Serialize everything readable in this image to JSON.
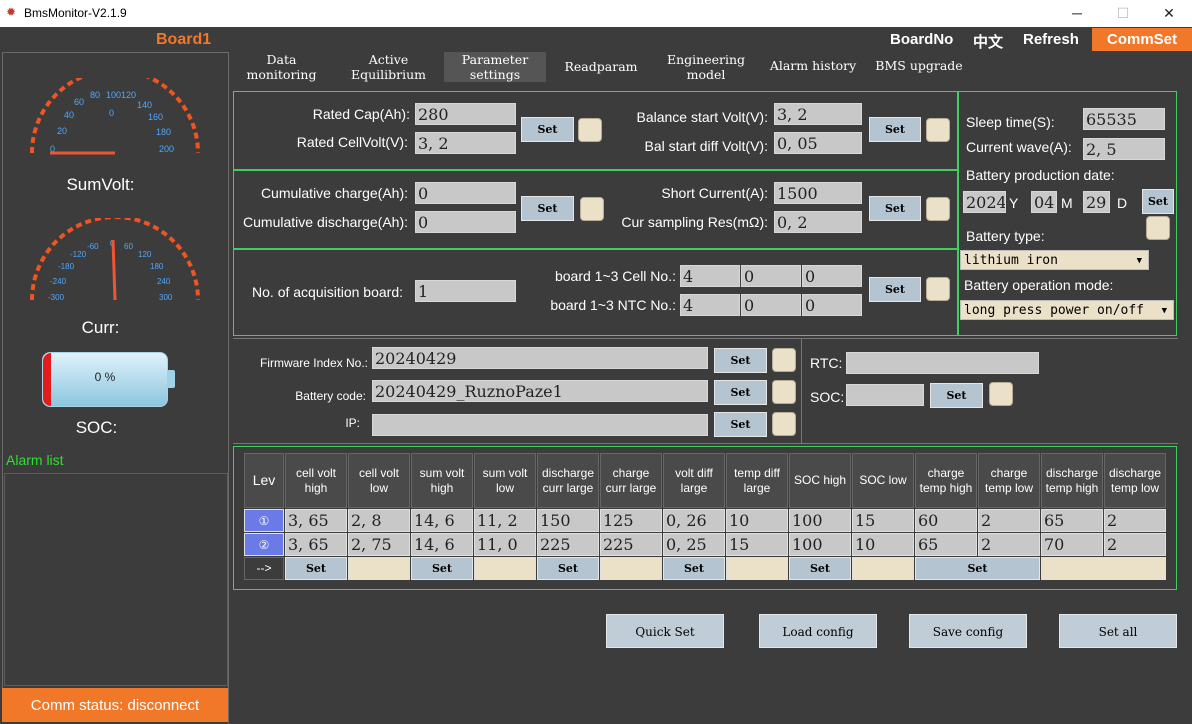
{
  "window": {
    "title": "BmsMonitor-V2.1.9",
    "minimize": "─",
    "maximize": "☐",
    "close": "✕"
  },
  "header": {
    "board_title": "Board1",
    "board_no": "BoardNo",
    "lang": "中文",
    "refresh": "Refresh",
    "commset": "CommSet"
  },
  "tabs": [
    {
      "line1": "Data",
      "line2": "monitoring"
    },
    {
      "line1": "Active",
      "line2": "Equilibrium"
    },
    {
      "line1": "Parameter",
      "line2": "settings"
    },
    {
      "line1": "Readparam",
      "line2": ""
    },
    {
      "line1": "Engineering",
      "line2": "model"
    },
    {
      "line1": "Alarm history",
      "line2": ""
    },
    {
      "line1": "BMS upgrade",
      "line2": ""
    }
  ],
  "left": {
    "sumvolt": {
      "label": "SumVolt:",
      "ticks": [
        "0",
        "20",
        "40",
        "60",
        "80",
        "100",
        "120",
        "140",
        "160",
        "180",
        "200"
      ],
      "center_tick": "0",
      "value": 0,
      "min": 0,
      "max": 200
    },
    "curr": {
      "label": "Curr:",
      "ticks": [
        "-300",
        "-240",
        "-180",
        "-120",
        "-60",
        "0",
        "60",
        "120",
        "180",
        "240",
        "300"
      ],
      "value": 0,
      "min": -300,
      "max": 300
    },
    "soc": {
      "label": "SOC:",
      "value_text": "0 %",
      "fraction": 0
    },
    "alarm_title": "Alarm list",
    "comm_status": "Comm status: disconnect"
  },
  "section1": {
    "rated_cap_label": "Rated Cap(Ah):",
    "rated_cap": "280",
    "rated_cellvolt_label": "Rated CellVolt(V):",
    "rated_cellvolt": "3, 2",
    "balance_start_label": "Balance start Volt(V):",
    "balance_start": "3, 2",
    "bal_start_diff_label": "Bal start diff Volt(V):",
    "bal_start_diff": "0, 05",
    "set": "Set"
  },
  "section2": {
    "cum_charge_label": "Cumulative charge(Ah):",
    "cum_charge": "0",
    "cum_discharge_label": "Cumulative discharge(Ah):",
    "cum_discharge": "0",
    "short_current_label": "Short Current(A):",
    "short_current": "1500",
    "cur_sampling_label": "Cur sampling Res(mΩ):",
    "cur_sampling": "0, 2",
    "set": "Set"
  },
  "section3": {
    "acq_label": "No. of acquisition board:",
    "acq": "1",
    "cell_no_label": "board 1~3 Cell No.:",
    "cell_no": [
      "4",
      "0",
      "0"
    ],
    "ntc_no_label": "board 1~3 NTC No.:",
    "ntc_no": [
      "4",
      "0",
      "0"
    ],
    "set": "Set"
  },
  "right": {
    "sleep_label": "Sleep time(S):",
    "sleep": "65535",
    "wave_label": "Current wave(A):",
    "wave": "2, 5",
    "prod_date_label": "Battery production date:",
    "year": "2024",
    "year_unit": "Y",
    "month": "04",
    "month_unit": "M",
    "day": "29",
    "day_unit": "D",
    "set": "Set",
    "type_label": "Battery type:",
    "type": "lithium iron",
    "mode_label": "Battery operation mode:",
    "mode": "long press power on/off"
  },
  "section4": {
    "fw_label": "Firmware Index No.:",
    "fw": "20240429",
    "code_label": "Battery code:",
    "code": "20240429_RuznoPaze1",
    "ip_label": "IP:",
    "ip": "",
    "rtc_label": "RTC:",
    "rtc": "",
    "soc_label": "SOC:",
    "soc": "",
    "set": "Set"
  },
  "alarm_table": {
    "lev_header": "Lev",
    "headers": [
      "cell volt high",
      "cell volt low",
      "sum volt high",
      "sum volt low",
      "discharge curr large",
      "charge curr large",
      "volt diff large",
      "temp diff large",
      "SOC high",
      "SOC low",
      "charge temp high",
      "charge temp low",
      "discharge temp high",
      "discharge temp low"
    ],
    "rows": [
      {
        "lev": "①",
        "values": [
          "3, 65",
          "2, 8",
          "14, 6",
          "11, 2",
          "150",
          "125",
          "0, 26",
          "10",
          "100",
          "15",
          "60",
          "2",
          "65",
          "2"
        ]
      },
      {
        "lev": "②",
        "values": [
          "3, 65",
          "2, 75",
          "14, 6",
          "11, 0",
          "225",
          "225",
          "0, 25",
          "15",
          "100",
          "10",
          "65",
          "2",
          "70",
          "2"
        ]
      }
    ],
    "arrow": "-->",
    "set": "Set"
  },
  "bottom": {
    "quick_set": "Quick Set",
    "load_config": "Load config",
    "save_config": "Save config",
    "set_all": "Set all"
  },
  "colors": {
    "accent": "#f07828",
    "panel_border": "#3fcf5f",
    "input": "#c8c8c8",
    "checkbox": "#ebe0c8",
    "button": "#b4c4d0",
    "level": "#6a7be8",
    "alarm_title": "#2fe02f"
  }
}
